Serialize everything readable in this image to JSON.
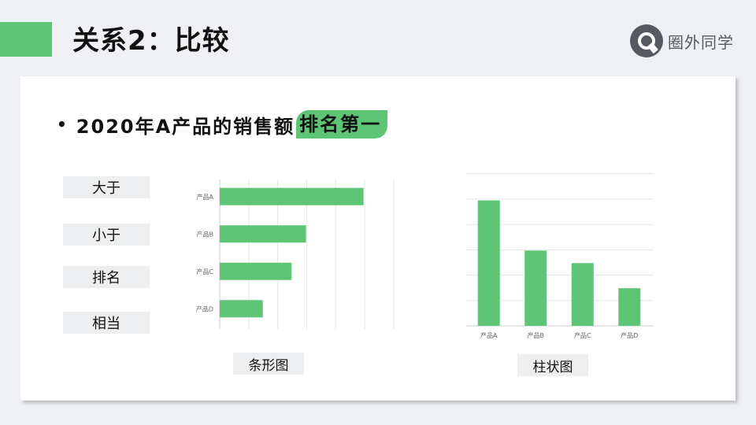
{
  "header": {
    "title": "关系2：比较"
  },
  "brand": {
    "name": "圈外同学",
    "icon": "q-logo-icon"
  },
  "headline": {
    "text": "2020年A产品的销售额",
    "highlight": "排名第一"
  },
  "tags": [
    "大于",
    "小于",
    "排名",
    "相当"
  ],
  "colors": {
    "accent": "#5ec576",
    "grid": "#e3e6e8",
    "axis": "#c9cdd0"
  },
  "captions": {
    "bar": "条形图",
    "column": "柱状图"
  },
  "chart_data": [
    {
      "type": "bar",
      "orientation": "horizontal",
      "categories": [
        "产品A",
        "产品B",
        "产品C",
        "产品D"
      ],
      "values": [
        100,
        60,
        50,
        30
      ],
      "grid": true,
      "title": "",
      "xlabel": "",
      "ylabel": ""
    },
    {
      "type": "bar",
      "orientation": "vertical",
      "categories": [
        "产品A",
        "产品B",
        "产品C",
        "产品D"
      ],
      "values": [
        100,
        60,
        50,
        30
      ],
      "grid": true,
      "title": "",
      "xlabel": "",
      "ylabel": ""
    }
  ]
}
